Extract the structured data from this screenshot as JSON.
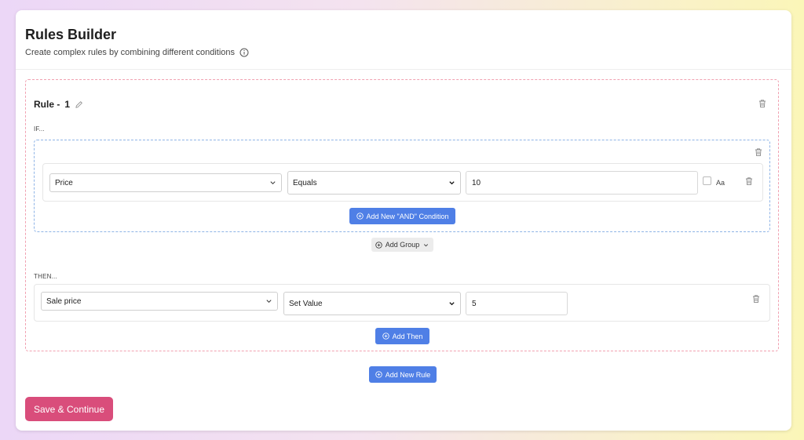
{
  "header": {
    "title": "Rules Builder",
    "subtitle": "Create complex rules by combining different conditions"
  },
  "rule": {
    "title_prefix": "Rule -",
    "number": "1",
    "if_label": "IF...",
    "then_label": "THEN...",
    "condition": {
      "field": "Price",
      "operator": "Equals",
      "value": "10",
      "case_label": "Aa"
    },
    "add_and_label": "Add New \"AND\" Condition",
    "add_group_label": "Add Group",
    "action": {
      "field": "Sale price",
      "operation": "Set Value",
      "value": "5"
    },
    "add_then_label": "Add Then"
  },
  "add_rule_label": "Add New Rule",
  "save_label": "Save & Continue",
  "colors": {
    "primary_blue": "#4f7fe6",
    "save_pink": "#d94d7b",
    "rule_border": "#f1a1b1",
    "group_border": "#8fb4e6"
  }
}
